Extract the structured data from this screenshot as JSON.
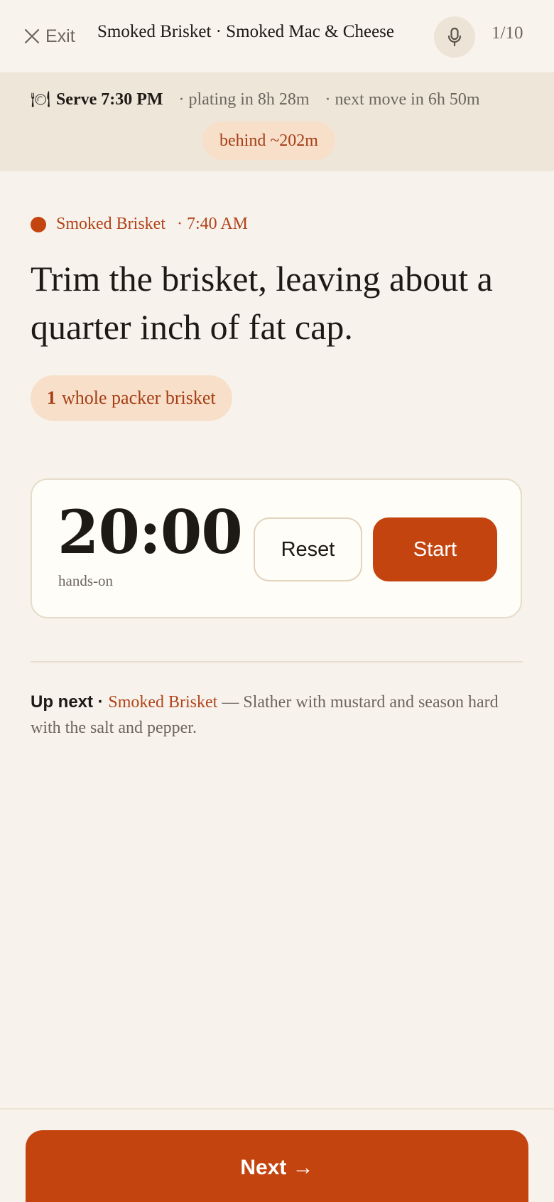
{
  "header": {
    "exit_label": "Exit",
    "title": "Smoked Brisket · Smoked Mac & Cheese",
    "step_counter": "1/10"
  },
  "status": {
    "serve_icon": "🍽",
    "serve_time": "Serve 7:30 PM",
    "plating": "· plating in 8h 28m",
    "next_move": "· next move in 6h 50m",
    "behind": "behind ~202m"
  },
  "step": {
    "recipe": "Smoked Brisket",
    "time": "· 7:40 AM",
    "instruction": "Trim the brisket, leaving about a quarter inch of fat cap.",
    "ingredient": {
      "quantity": "1",
      "name": "whole packer brisket"
    }
  },
  "timer": {
    "value": "20:00",
    "label": "hands-on",
    "reset_label": "Reset",
    "start_label": "Start"
  },
  "up_next": {
    "label": "Up next",
    "separator": " · ",
    "recipe": "Smoked Brisket",
    "text": " — Slather with mustard and season hard with the salt and pepper."
  },
  "footer": {
    "next_label": "Next →"
  },
  "colors": {
    "accent": "#c4440f",
    "accent_text": "#b2431a",
    "pill_bg": "#f7dfc9",
    "background": "#f7f3ec"
  }
}
